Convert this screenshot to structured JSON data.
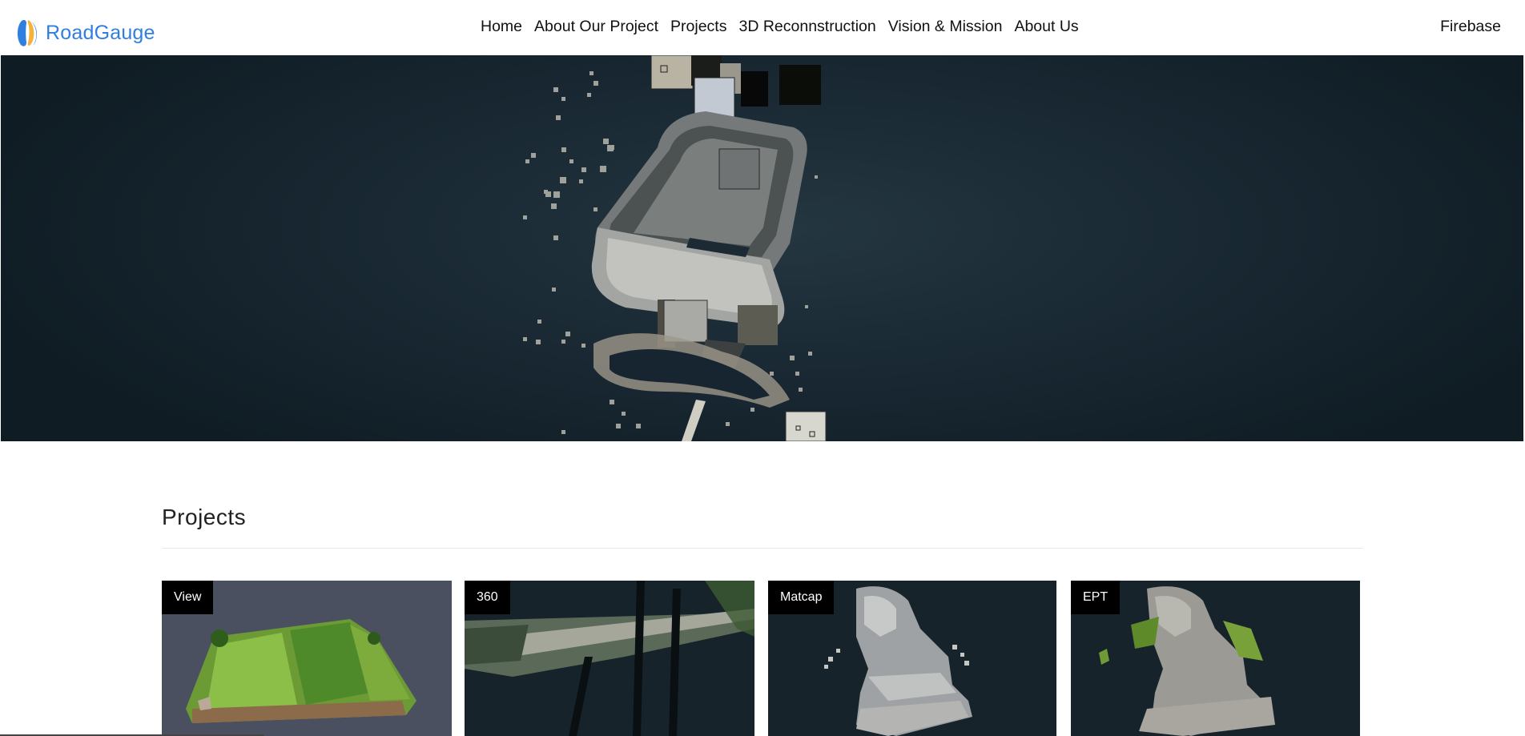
{
  "brand": {
    "name": "RoadGauge",
    "accent": "#2f7fe0"
  },
  "nav": {
    "links": [
      "Home",
      "About Our Project",
      "Projects",
      "3D Reconnstruction",
      "Vision & Mission",
      "About Us"
    ],
    "right": "Firebase"
  },
  "hero": {
    "content": "3D point-cloud rendering of a chair on dark background"
  },
  "projects": {
    "title": "Projects",
    "cards": [
      {
        "tag": "View"
      },
      {
        "tag": "360"
      },
      {
        "tag": "Matcap"
      },
      {
        "tag": "EPT"
      }
    ]
  }
}
